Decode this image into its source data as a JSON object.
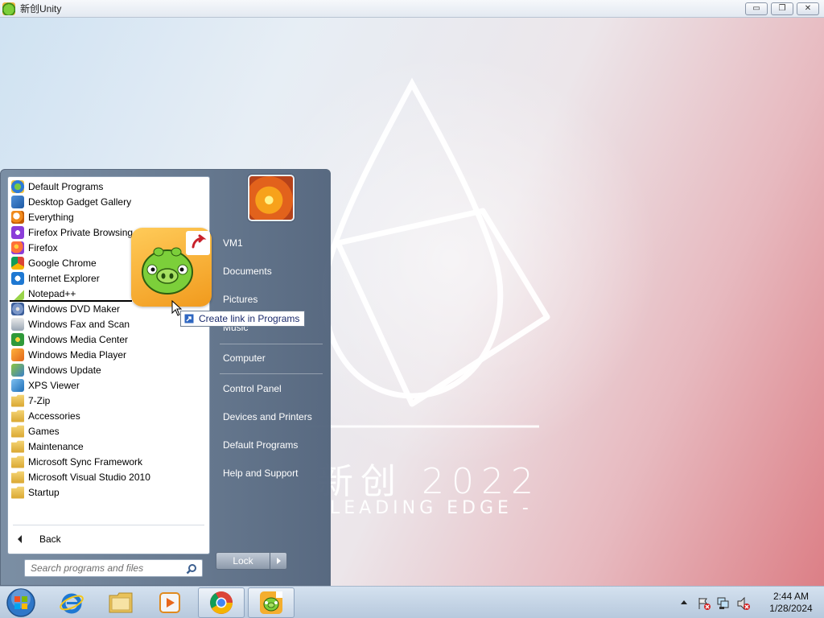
{
  "window": {
    "title": "新创Unity",
    "min_glyph": "▭",
    "restore_glyph": "❐",
    "close_glyph": "✕"
  },
  "wallpaper": {
    "title": "新创 2022",
    "subtitle": "LEADING EDGE -"
  },
  "start_menu": {
    "programs": [
      {
        "label": "Default Programs",
        "icon": "default-programs-icon"
      },
      {
        "label": "Desktop Gadget Gallery",
        "icon": "gadget-gallery-icon"
      },
      {
        "label": "Everything",
        "icon": "everything-search-icon"
      },
      {
        "label": "Firefox Private Browsing",
        "icon": "firefox-private-icon"
      },
      {
        "label": "Firefox",
        "icon": "firefox-icon"
      },
      {
        "label": "Google Chrome",
        "icon": "chrome-icon"
      },
      {
        "label": "Internet Explorer",
        "icon": "internet-explorer-icon"
      },
      {
        "label": "Notepad++",
        "icon": "notepad-plus-plus-icon"
      },
      {
        "label": "Windows DVD Maker",
        "icon": "dvd-maker-icon"
      },
      {
        "label": "Windows Fax and Scan",
        "icon": "fax-scan-icon"
      },
      {
        "label": "Windows Media Center",
        "icon": "media-center-icon"
      },
      {
        "label": "Windows Media Player",
        "icon": "media-player-icon"
      },
      {
        "label": "Windows Update",
        "icon": "windows-update-icon"
      },
      {
        "label": "XPS Viewer",
        "icon": "xps-viewer-icon"
      },
      {
        "label": "7-Zip",
        "icon": "folder-icon"
      },
      {
        "label": "Accessories",
        "icon": "folder-icon"
      },
      {
        "label": "Games",
        "icon": "folder-icon"
      },
      {
        "label": "Maintenance",
        "icon": "folder-icon"
      },
      {
        "label": "Microsoft Sync Framework",
        "icon": "folder-icon"
      },
      {
        "label": "Microsoft Visual Studio 2010",
        "icon": "folder-icon"
      },
      {
        "label": "Startup",
        "icon": "folder-icon"
      }
    ],
    "back_label": "Back",
    "search_placeholder": "Search programs and files",
    "right_items": {
      "user": "VM1",
      "documents": "Documents",
      "pictures": "Pictures",
      "music": "Music",
      "computer": "Computer",
      "control_panel": "Control Panel",
      "devices": "Devices and Printers",
      "default_programs": "Default Programs",
      "help": "Help and Support"
    },
    "lock_label": "Lock"
  },
  "drag": {
    "tooltip": "Create link in Programs"
  },
  "taskbar": {
    "pinned": [
      "internet-explorer-icon",
      "explorer-folder-icon",
      "media-player-icon",
      "chrome-icon",
      "unity-game-icon"
    ],
    "clock_time": "2:44 AM",
    "clock_date": "1/28/2024"
  },
  "colors": {
    "accent": "#2f67c1",
    "taskbar": "#c4d4e6",
    "start_panel": "#6c8099"
  }
}
